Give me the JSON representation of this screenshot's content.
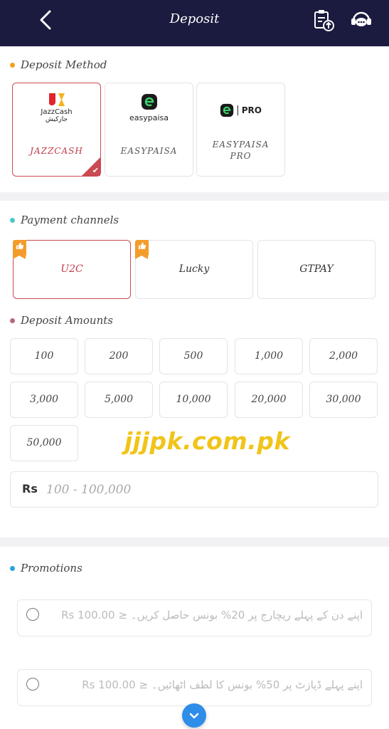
{
  "header": {
    "title": "Deposit",
    "icons": [
      "back-chevron-icon",
      "clipboard-upload-icon",
      "support-chat-icon"
    ]
  },
  "deposit_method": {
    "title": "Deposit Method",
    "dot_color": "#f0a21c",
    "methods": [
      {
        "logo_text": "JazzCash",
        "logo_subtext": "جازکیش",
        "label": "JAZZCASH",
        "selected": true
      },
      {
        "logo_text": "easypaisa",
        "label": "EASYPAISA",
        "selected": false
      },
      {
        "logo_text": "PRO",
        "label": "EASYPAISA PRO",
        "selected": false
      }
    ]
  },
  "payment_channels": {
    "title": "Payment channels",
    "dot_color": "#4ec7c7",
    "channels": [
      {
        "label": "U2C",
        "selected": true,
        "badge": true
      },
      {
        "label": "Lucky",
        "selected": false,
        "badge": true
      },
      {
        "label": "GTPAY",
        "selected": false,
        "badge": false
      }
    ]
  },
  "deposit_amounts": {
    "title": "Deposit Amounts",
    "dot_color": "#b86a7a",
    "amounts": [
      "100",
      "200",
      "500",
      "1,000",
      "2,000",
      "3,000",
      "5,000",
      "10,000",
      "20,000",
      "30,000",
      "50,000"
    ]
  },
  "amount_input": {
    "currency": "Rs",
    "placeholder": "100 - 100,000"
  },
  "watermark": "jjjpk.com.pk",
  "promotions": {
    "title": "Promotions",
    "dot_color": "#2aa3e0",
    "items": [
      {
        "text": "Rs 100.00 ≥ اپنے دن کے پہلے ریچارج پر 20% بونس حاصل کریں۔"
      },
      {
        "text": "Rs 100.00 ≥ اپنے پہلے ڈپازٹ پر 50% بونس کا لطف اٹھائیں۔"
      }
    ]
  },
  "colors": {
    "header_bg": "#1b1b40",
    "accent_red": "#c94a52",
    "badge_orange": "#f39c2b",
    "fab_blue": "#2d8de8"
  }
}
